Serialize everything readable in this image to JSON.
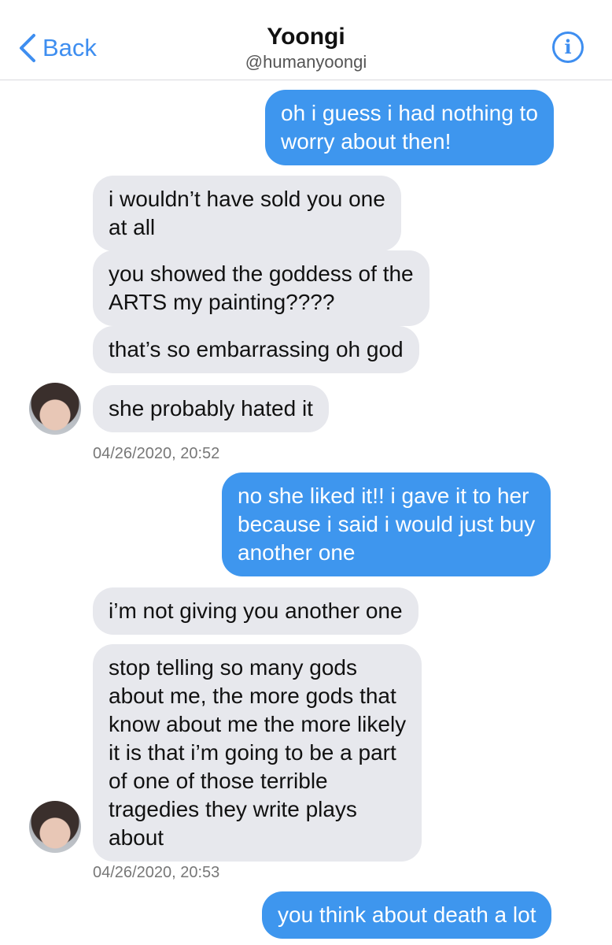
{
  "header": {
    "back_label": "Back",
    "name": "Yoongi",
    "handle": "@humanyoongi",
    "info_glyph": "i"
  },
  "messages": [
    {
      "side": "out",
      "lines": [
        "oh i guess i had nothing to",
        "worry about then!"
      ]
    },
    {
      "side": "in",
      "lines": [
        "i wouldn’t have sold you one",
        "at all"
      ]
    },
    {
      "side": "in",
      "lines": [
        "you showed the goddess of the",
        "ARTS my painting????"
      ]
    },
    {
      "side": "in",
      "lines": [
        "that’s so embarrassing oh god"
      ]
    },
    {
      "side": "in",
      "lines": [
        "she probably hated it"
      ]
    },
    {
      "side": "out",
      "lines": [
        "no she liked it!! i gave it to her",
        "because i said i would just buy",
        "another one"
      ]
    },
    {
      "side": "in",
      "lines": [
        "i’m not giving you another one"
      ]
    },
    {
      "side": "in",
      "lines": [
        "stop telling so many gods",
        "about me, the more gods that",
        "know about me the more likely",
        "it is that i’m going to be a part",
        "of one of those terrible",
        "tragedies they write plays",
        "about"
      ]
    },
    {
      "side": "out",
      "lines": [
        "you think about death a lot"
      ]
    }
  ],
  "timestamps": [
    "04/26/2020, 20:52",
    "04/26/2020, 20:53"
  ],
  "icons": {
    "back": "chevron-left-icon",
    "info": "info-icon",
    "avatar": "avatar"
  },
  "colors": {
    "accent": "#3e8ef0",
    "outgoing_bubble": "#3e96ee",
    "incoming_bubble": "#e7e8ed"
  }
}
